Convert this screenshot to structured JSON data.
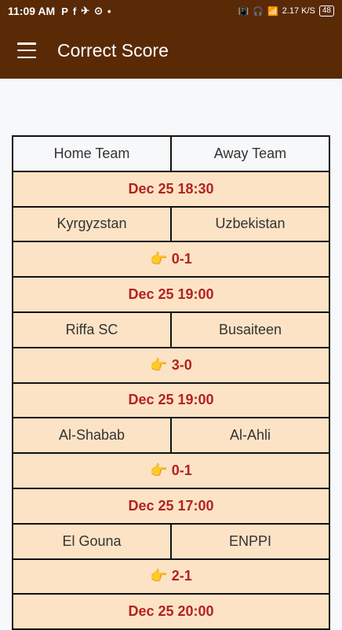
{
  "status_bar": {
    "time": "11:09 AM",
    "notifications": [
      "P",
      "f",
      "✈",
      "⊙",
      "•"
    ],
    "network_speed": "2.17\nK/S",
    "battery": "48"
  },
  "app_bar": {
    "title": "Correct Score",
    "menu_icon": "hamburger-menu-icon"
  },
  "table": {
    "headers": [
      "Home Team",
      "Away Team"
    ],
    "matches": [
      {
        "date": "Dec 25 18:30",
        "home": "Kyrgyzstan",
        "away": "Uzbekistan",
        "score": "👉 0-1"
      },
      {
        "date": "Dec 25 19:00",
        "home": "Riffa SC",
        "away": "Busaiteen",
        "score": "👉 3-0"
      },
      {
        "date": "Dec 25 19:00",
        "home": "Al-Shabab",
        "away": "Al-Ahli",
        "score": "👉 0-1"
      },
      {
        "date": "Dec 25 17:00",
        "home": "El Gouna",
        "away": "ENPPI",
        "score": "👉 2-1"
      },
      {
        "date": "Dec 25 20:00"
      }
    ]
  },
  "colors": {
    "bar": "#5a2a07",
    "row_bg": "#fde3c5",
    "accent_text": "#b22222"
  }
}
